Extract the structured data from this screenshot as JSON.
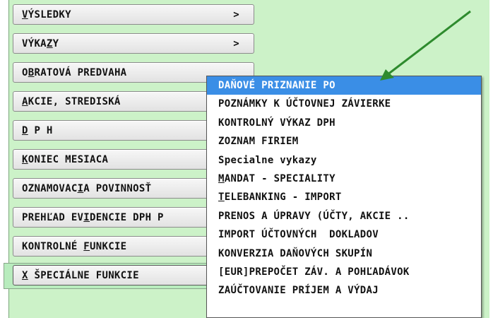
{
  "menu": {
    "items": [
      {
        "pre": "",
        "u": "V",
        "post": "ÝSLEDKY",
        "arrow": ">"
      },
      {
        "pre": "VÝKA",
        "u": "Z",
        "post": "Y",
        "arrow": ">"
      },
      {
        "pre": "O",
        "u": "B",
        "post": "RATOVÁ PREDVAHA",
        "arrow": ""
      },
      {
        "pre": "",
        "u": "A",
        "post": "KCIE, STREDISKÁ",
        "arrow": ""
      },
      {
        "pre": "",
        "u": "D",
        "post": " P H",
        "arrow": ""
      },
      {
        "pre": "",
        "u": "K",
        "post": "ONIEC MESIACA",
        "arrow": ""
      },
      {
        "pre": "OZNAMOVAC",
        "u": "I",
        "post": "A POVINNOSŤ",
        "arrow": ""
      },
      {
        "pre": "PREHĽAD EV",
        "u": "I",
        "post": "DENCIE DPH P",
        "arrow": ""
      },
      {
        "pre": "KONTROLNÉ ",
        "u": "F",
        "post": "UNKCIE",
        "arrow": ""
      }
    ],
    "selected": {
      "pre": "",
      "u": "X",
      "post": " ŠPECIÁLNE FUNKCIE"
    }
  },
  "submenu": {
    "items": [
      {
        "pre": "",
        "u": "",
        "post": "DAŇOVÉ PRIZNANIE PO"
      },
      {
        "pre": "",
        "u": "",
        "post": "POZNÁMKY K ÚČTOVNEJ ZÁVIERKE"
      },
      {
        "pre": "",
        "u": "",
        "post": "KONTROLNÝ VÝKAZ DPH"
      },
      {
        "pre": "",
        "u": "",
        "post": "ZOZNAM FIRIEM"
      },
      {
        "pre": "",
        "u": "",
        "post": "Specialne vykazy"
      },
      {
        "pre": "",
        "u": "M",
        "post": "ANDAT - SPECIALITY"
      },
      {
        "pre": "",
        "u": "T",
        "post": "ELEBANKING - IMPORT"
      },
      {
        "pre": "",
        "u": "",
        "post": "PRENOS A ÚPRAVY (ÚČTY, AKCIE .."
      },
      {
        "pre": "",
        "u": "",
        "post": "IMPORT ÚČTOVNÝCH  DOKLADOV"
      },
      {
        "pre": "",
        "u": "",
        "post": "KONVERZIA DAŇOVÝCH SKUPÍN"
      },
      {
        "pre": "",
        "u": "",
        "post": "[EUR]PREPOČET ZÁV. A POHĽADÁVOK"
      },
      {
        "pre": "",
        "u": "",
        "post": "ZAÚČTOVANIE PRÍJEM A VÝDAJ"
      }
    ],
    "highlighted_index": 0
  },
  "colors": {
    "background": "#ccf2c8",
    "highlight": "#3a8ee6",
    "arrow": "#2e8b2e"
  }
}
